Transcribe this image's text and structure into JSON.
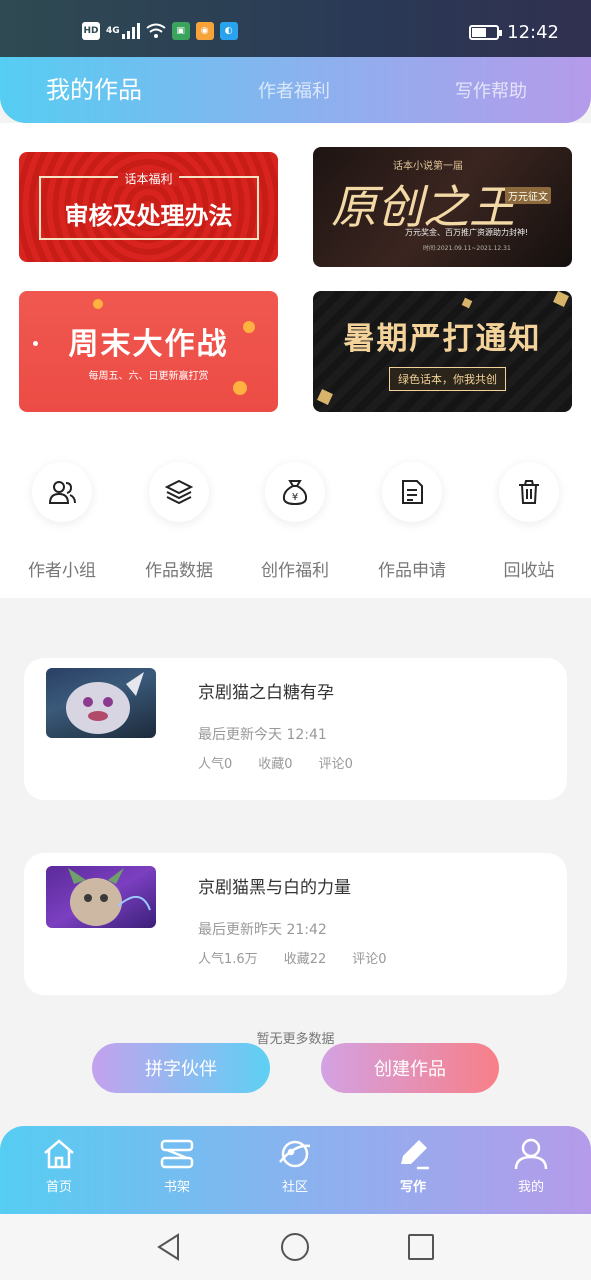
{
  "status_bar": {
    "time": "12:42",
    "hd": "HD",
    "network": "4G"
  },
  "top_tabs": [
    {
      "label": "我的作品",
      "active": true
    },
    {
      "label": "作者福利",
      "active": false
    },
    {
      "label": "写作帮助",
      "active": false
    }
  ],
  "banners": {
    "review": {
      "small": "话本福利",
      "big": "审核及处理办法"
    },
    "original": {
      "small": "话本小说第一届",
      "big": "原创之王",
      "tag": "万元征文",
      "line1": "万元奖金、百万推广资源助力封神!",
      "line2": "时间:2021.09.11~2021.12.31"
    },
    "weekend": {
      "big": "周末大作战",
      "small": "每周五、六、日更新赢打赏"
    },
    "summer": {
      "big": "暑期严打通知",
      "pill": "绿色话本，你我共创"
    }
  },
  "quick_actions": [
    {
      "label": "作者小组",
      "icon": "people-icon"
    },
    {
      "label": "作品数据",
      "icon": "layers-icon"
    },
    {
      "label": "创作福利",
      "icon": "money-bag-icon"
    },
    {
      "label": "作品申请",
      "icon": "document-icon"
    },
    {
      "label": "回收站",
      "icon": "trash-icon"
    }
  ],
  "works": [
    {
      "title": "京剧猫之白糖有孕",
      "updated": "最后更新今天 12:41",
      "popularity": "人气0",
      "favorites": "收藏0",
      "comments": "评论0"
    },
    {
      "title": "京剧猫黑与白的力量",
      "updated": "最后更新昨天 21:42",
      "popularity": "人气1.6万",
      "favorites": "收藏22",
      "comments": "评论0"
    }
  ],
  "no_more": "暂无更多数据",
  "buttons": {
    "partner": "拼字伙伴",
    "create": "创建作品"
  },
  "bottom_nav": [
    {
      "label": "首页",
      "icon": "home-icon"
    },
    {
      "label": "书架",
      "icon": "bookshelf-icon"
    },
    {
      "label": "社区",
      "icon": "planet-icon"
    },
    {
      "label": "写作",
      "icon": "pen-icon",
      "active": true
    },
    {
      "label": "我的",
      "icon": "user-icon"
    }
  ],
  "colors": {
    "accent_start": "#56cdf2",
    "accent_end": "#b59bea",
    "create_end": "#f77f88"
  }
}
